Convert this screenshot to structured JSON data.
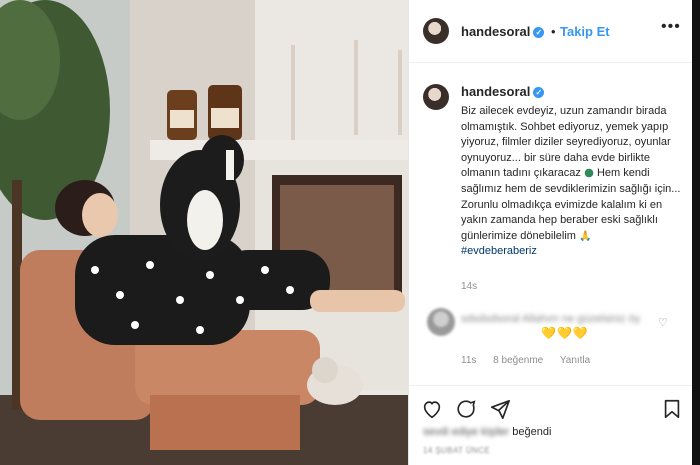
{
  "post": {
    "username": "handesoral",
    "follow_label": "Takip Et",
    "separator": "•",
    "more_icon": "•••",
    "caption": {
      "part1": "Biz ailecek evdeyiz, uzun zamandır birada olmamıştık. Sohbet ediyoruz, yemek yapıp yiyoruz, filmler diziler seyrediyoruz, oyunlar oynuyoruz... bir süre daha evde birlikte olmanın tadını çıkaracaz",
      "part2": " Hem kendi sağlımız hem de sevdiklerimizin sağlığı için... Zorunlu olmadıkça evimizde kalalım ki en yakın zamanda hep beraber eski sağlıklı günlerimize dönebilelim",
      "hashtag": "#evdeberaberiz"
    },
    "caption_time": "14s",
    "comment": {
      "text": "sdsdsdsoral Allahım ne güzelsiniz öy",
      "hearts": "💛💛💛",
      "time": "11s",
      "likes": "8 beğenme",
      "reply": "Yanıtla"
    },
    "likes_text_blurred": "sevdi ediye kişiler",
    "likes_suffix": "beğendi",
    "date": "14 ŞUBAT ÜNCE"
  },
  "colors": {
    "accent": "#3897f0",
    "text": "#262626",
    "muted": "#8e8e8e"
  }
}
